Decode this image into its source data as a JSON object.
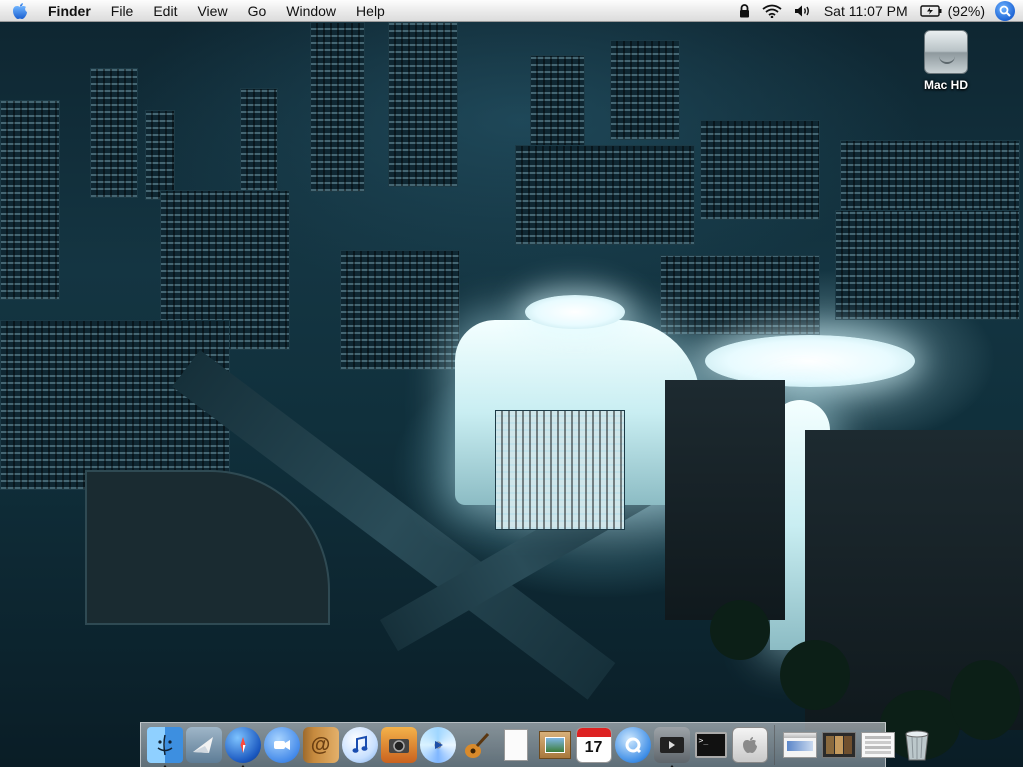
{
  "menubar": {
    "app_name": "Finder",
    "menus": [
      "File",
      "Edit",
      "View",
      "Go",
      "Window",
      "Help"
    ],
    "clock": "Sat 11:07 PM",
    "battery": "(92%)"
  },
  "desktop": {
    "icons": [
      {
        "label": "Mac HD",
        "icon": "hard-drive-icon"
      }
    ]
  },
  "dock": {
    "apps": [
      {
        "name": "finder-icon",
        "running": true
      },
      {
        "name": "mail-icon",
        "running": false
      },
      {
        "name": "safari-icon",
        "running": true
      },
      {
        "name": "ichat-icon",
        "running": false
      },
      {
        "name": "address-book-icon",
        "running": false
      },
      {
        "name": "itunes-icon",
        "running": false
      },
      {
        "name": "iphoto-icon",
        "running": false
      },
      {
        "name": "idvd-icon",
        "running": false
      },
      {
        "name": "garageband-icon",
        "running": false
      },
      {
        "name": "textedit-icon",
        "running": false
      },
      {
        "name": "preview-icon",
        "running": false
      },
      {
        "name": "ical-icon",
        "running": false,
        "text": "17"
      },
      {
        "name": "quicktime-icon",
        "running": false
      },
      {
        "name": "front-row-icon",
        "running": true
      },
      {
        "name": "terminal-icon",
        "running": false
      },
      {
        "name": "system-profiler-icon",
        "running": false
      }
    ],
    "docs": [
      {
        "name": "minimized-window-1-icon"
      },
      {
        "name": "minimized-window-2-icon"
      },
      {
        "name": "minimized-window-3-icon"
      },
      {
        "name": "trash-icon"
      }
    ]
  }
}
